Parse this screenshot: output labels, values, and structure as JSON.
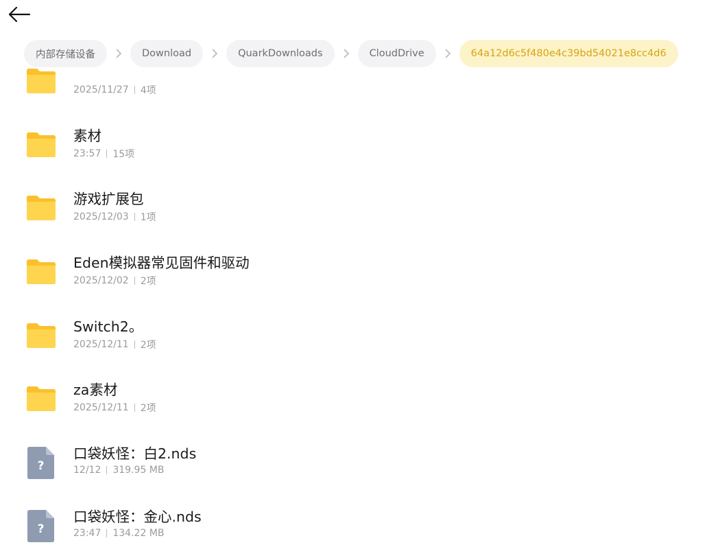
{
  "breadcrumb": {
    "items": [
      "内部存储设备",
      "Download",
      "QuarkDownloads",
      "CloudDrive",
      "64a12d6c5f480e4c39bd54021e8cc4d6"
    ]
  },
  "files": [
    {
      "name": "",
      "date": "2025/11/27",
      "info": "4项",
      "type": "folder"
    },
    {
      "name": "素材",
      "date": "23:57",
      "info": "15项",
      "type": "folder"
    },
    {
      "name": "游戏扩展包",
      "date": "2025/12/03",
      "info": "1项",
      "type": "folder"
    },
    {
      "name": "Eden模拟器常见固件和驱动",
      "date": "2025/12/02",
      "info": "2项",
      "type": "folder"
    },
    {
      "name": "Switch2。",
      "date": "2025/12/11",
      "info": "2项",
      "type": "folder"
    },
    {
      "name": "za素材",
      "date": "2025/12/11",
      "info": "2项",
      "type": "folder"
    },
    {
      "name": "口袋妖怪：白2.nds",
      "date": "12/12",
      "info": "319.95 MB",
      "type": "unknown-file"
    },
    {
      "name": "口袋妖怪：金心.nds",
      "date": "23:47",
      "info": "134.22 MB",
      "type": "unknown-file"
    }
  ],
  "colors": {
    "folder": "#fbc02d",
    "folder_light": "#ffd54f",
    "unknown_file": "#8e9bb0",
    "active_crumb_bg": "#fdf3c8",
    "active_crumb_text": "#d4a514"
  }
}
